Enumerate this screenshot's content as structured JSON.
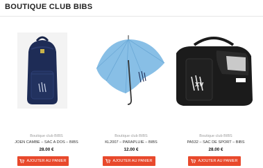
{
  "page": {
    "title": "BOUTIQUE CLUB BIBS"
  },
  "products": [
    {
      "brand": "Boutique club BIBS",
      "name": "JOEN CAMBE – SAC A DOS – BIBS",
      "price": "28.00 €",
      "button_label": "AJOUTER AU PANIER",
      "image_icon": "backpack-icon"
    },
    {
      "brand": "Boutique club BIBS",
      "name": "KL2007 – PARAPLUIE – BIBS",
      "price": "12.00 €",
      "button_label": "AJOUTER AU PANIER",
      "image_icon": "umbrella-icon"
    },
    {
      "brand": "Boutique club BIBS",
      "name": "PA532 – SAC DE SPORT – BIBS",
      "price": "28.00 €",
      "button_label": "AJOUTER AU PANIER",
      "image_icon": "sports-bag-icon"
    }
  ],
  "colors": {
    "accent": "#e8492c",
    "backpack": "#1e2c56",
    "umbrella": "#88bfe6",
    "sports_bag": "#1b1b1b"
  }
}
